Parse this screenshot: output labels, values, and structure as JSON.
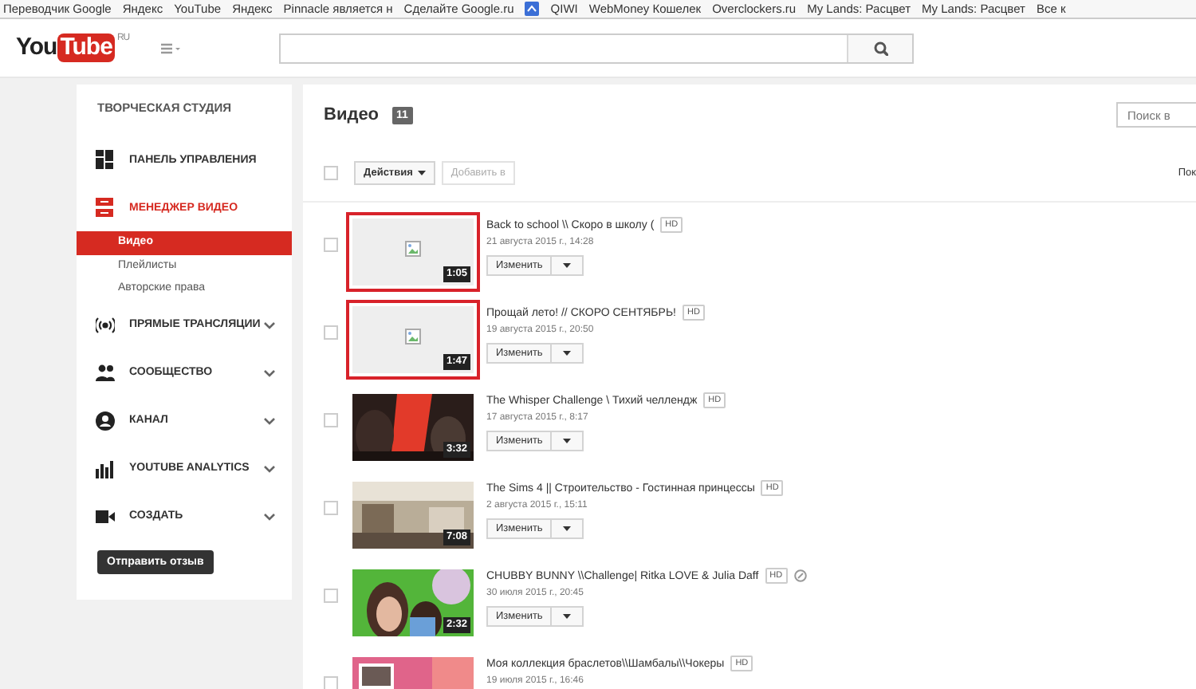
{
  "bookmarks": [
    "Переводчик Google",
    "Яндекс",
    "YouTube",
    "Яндекс",
    "Pinnacle является н",
    "Сделайте Google.ru",
    "QIWI",
    "WebMoney Кошелек",
    "Overclockers.ru",
    "My Lands: Расцвет",
    "My Lands: Расцвет",
    "Все к"
  ],
  "header": {
    "logo_you": "You",
    "logo_tube": "Tube",
    "logo_region": "RU"
  },
  "sidebar": {
    "title": "ТВОРЧЕСКАЯ СТУДИЯ",
    "items": [
      {
        "label": "ПАНЕЛЬ УПРАВЛЕНИЯ",
        "active": false,
        "has_chevron": false
      },
      {
        "label": "МЕНЕДЖЕР ВИДЕО",
        "active": true,
        "has_chevron": false,
        "children": [
          {
            "label": "Видео",
            "selected": true
          },
          {
            "label": "Плейлисты",
            "selected": false
          },
          {
            "label": "Авторские права",
            "selected": false
          }
        ]
      },
      {
        "label": "ПРЯМЫЕ ТРАНСЛЯЦИИ",
        "active": false,
        "has_chevron": true
      },
      {
        "label": "СООБЩЕСТВО",
        "active": false,
        "has_chevron": true
      },
      {
        "label": "КАНАЛ",
        "active": false,
        "has_chevron": true
      },
      {
        "label": "YOUTUBE ANALYTICS",
        "active": false,
        "has_chevron": true
      },
      {
        "label": "СОЗДАТЬ",
        "active": false,
        "has_chevron": true
      }
    ],
    "feedback_button": "Отправить отзыв"
  },
  "main": {
    "title": "Видео",
    "count": "11",
    "search": {
      "placeholder": "Поиск в"
    },
    "toolbar": {
      "select_all_checked": false,
      "actions": "Действия",
      "add_to": {
        "label": "Добавить в",
        "disabled": true
      },
      "right_text": "Пок"
    },
    "videos": [
      {
        "checked": false,
        "title": "Back to school \\\\ Скоро в школу (",
        "badge": "HD",
        "date": "21 августа 2015 г., 14:28",
        "duration": "1:05",
        "image_loaded": false,
        "highlighted": true,
        "extra_icon": false,
        "edit": "Изменить"
      },
      {
        "checked": false,
        "title": "Прощай лето! // СКОРО СЕНТЯБРЬ!",
        "badge": "HD",
        "date": "19 августа 2015 г., 20:50",
        "duration": "1:47",
        "image_loaded": false,
        "highlighted": true,
        "extra_icon": false,
        "edit": "Изменить"
      },
      {
        "checked": false,
        "title": "The Whisper Challenge \\ Тихий челлендж",
        "badge": "HD",
        "date": "17 августа 2015 г., 8:17",
        "duration": "3:32",
        "image_loaded": true,
        "highlighted": false,
        "extra_icon": false,
        "edit": "Изменить"
      },
      {
        "checked": false,
        "title": "The Sims 4 || Строительство - Гостинная принцессы",
        "badge": "HD",
        "date": "2 августа 2015 г., 15:11",
        "duration": "7:08",
        "image_loaded": true,
        "highlighted": false,
        "extra_icon": false,
        "edit": "Изменить"
      },
      {
        "checked": false,
        "title": "CHUBBY BUNNY \\\\Challenge| Ritka LOVE & Julia Daff",
        "badge": "HD",
        "date": "30 июля 2015 г., 20:45",
        "duration": "2:32",
        "image_loaded": true,
        "highlighted": false,
        "extra_icon": true,
        "edit": "Изменить"
      },
      {
        "checked": false,
        "title": "Моя коллекция браслетов\\\\Шамбалы\\\\Чокеры",
        "badge": "HD",
        "date": "19 июля 2015 г., 16:46",
        "image_loaded": true,
        "highlighted": false,
        "extra_icon": false
      }
    ]
  }
}
